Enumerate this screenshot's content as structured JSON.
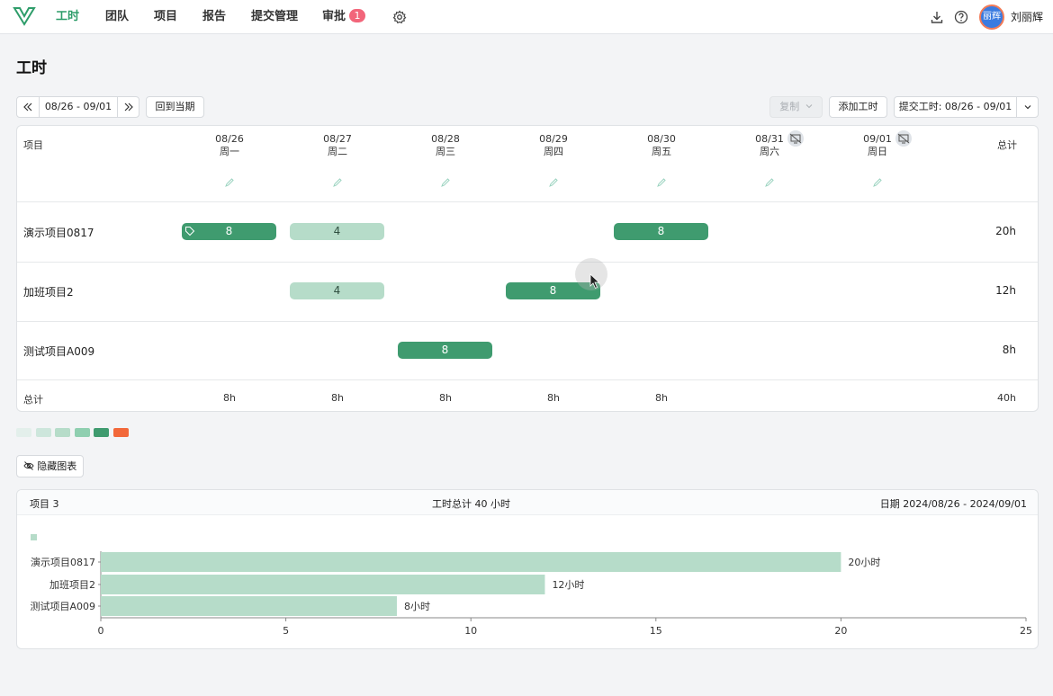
{
  "nav": {
    "items": [
      "工时",
      "团队",
      "项目",
      "报告",
      "提交管理",
      "审批"
    ],
    "approval_badge": "1",
    "user": "刘丽辉",
    "avatar_text": "丽辉"
  },
  "page": {
    "title": "工时"
  },
  "toolbar": {
    "prev_icon": "double-chevron-left-icon",
    "range": "08/26 - 09/01",
    "next_icon": "double-chevron-right-icon",
    "current_label": "回到当期",
    "copy_label": "复制",
    "add_label": "添加工时",
    "submit_label": "提交工时: 08/26 - 09/01"
  },
  "grid": {
    "project_header": "项目",
    "total_header": "总计",
    "days": [
      {
        "date": "08/26",
        "weekday": "周一"
      },
      {
        "date": "08/27",
        "weekday": "周二"
      },
      {
        "date": "08/28",
        "weekday": "周三"
      },
      {
        "date": "08/29",
        "weekday": "周四"
      },
      {
        "date": "08/30",
        "weekday": "周五"
      },
      {
        "date": "08/31",
        "weekday": "周六"
      },
      {
        "date": "09/01",
        "weekday": "周日"
      }
    ],
    "rows": [
      {
        "project": "演示项目0817",
        "hours": [
          8,
          4,
          null,
          null,
          8,
          null,
          null
        ],
        "total": "20h"
      },
      {
        "project": "加班项目2",
        "hours": [
          null,
          4,
          null,
          8,
          null,
          null,
          null
        ],
        "total": "12h"
      },
      {
        "project": "测试项目A009",
        "hours": [
          null,
          null,
          8,
          null,
          null,
          null,
          null
        ],
        "total": "8h"
      }
    ],
    "footer_label": "总计",
    "footer": [
      "8h",
      "8h",
      "8h",
      "8h",
      "8h",
      "",
      ""
    ],
    "footer_total": "40h"
  },
  "legend_colors": [
    "#e3efeb",
    "#cde6dc",
    "#b6dcc9",
    "#8fcfb0",
    "#3f9b6f",
    "#f2683a"
  ],
  "hide_chart_label": "隐藏图表",
  "chart_header": {
    "projects": "项目 3",
    "total": "工时总计 40 小时",
    "date": "日期 2024/08/26 - 2024/09/01"
  },
  "chart_data": {
    "type": "bar",
    "orientation": "horizontal",
    "categories": [
      "演示项目0817",
      "加班项目2",
      "测试项目A009"
    ],
    "values": [
      20,
      12,
      8
    ],
    "data_labels": [
      "20小时",
      "12小时",
      "8小时"
    ],
    "xlim": [
      0,
      25
    ],
    "x_ticks": [
      0,
      5,
      10,
      15,
      20,
      25
    ],
    "color": "#b6dcc9"
  }
}
